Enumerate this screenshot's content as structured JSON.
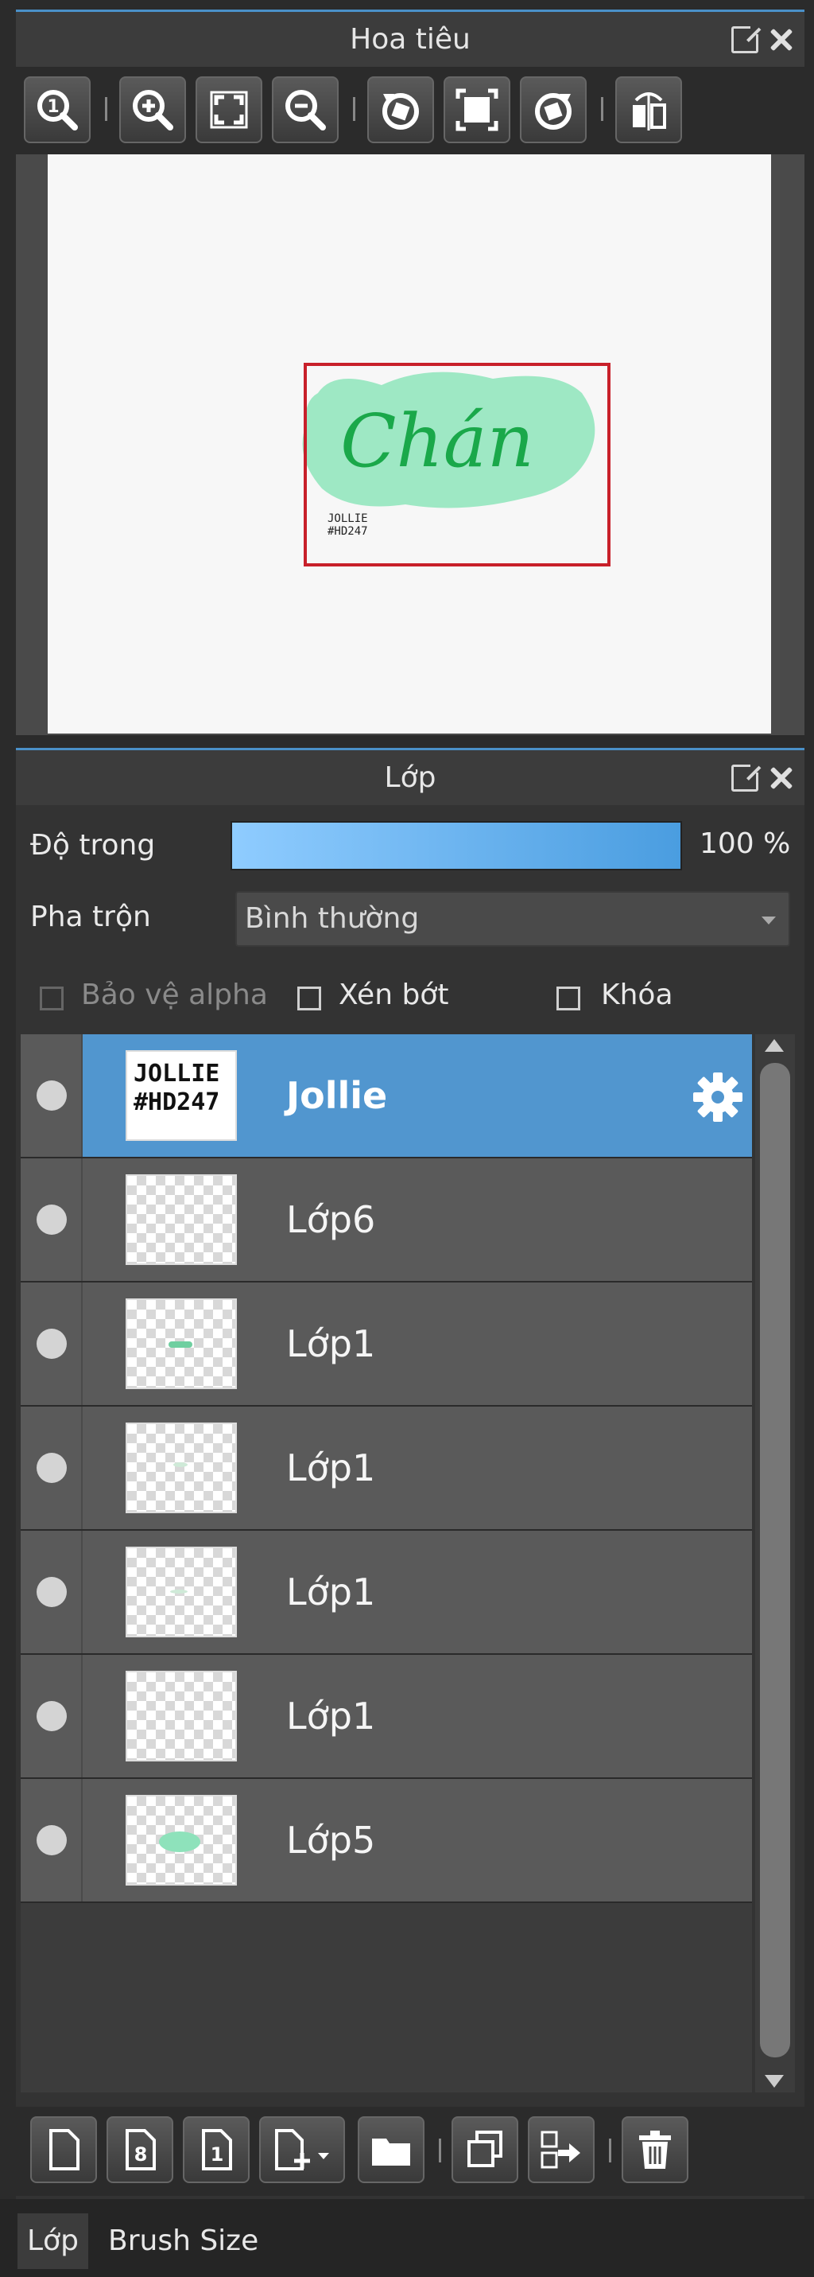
{
  "navigator": {
    "title": "Hoa tiêu",
    "tools": [
      {
        "icon": "zoom-actual-icon"
      },
      {
        "icon": "zoom-in-icon"
      },
      {
        "icon": "fit-screen-icon"
      },
      {
        "icon": "zoom-out-icon"
      },
      {
        "icon": "rotate-left-icon"
      },
      {
        "icon": "fit-canvas-icon"
      },
      {
        "icon": "rotate-right-icon"
      },
      {
        "icon": "flip-icon"
      }
    ],
    "canvas_preview_text": "Chán",
    "canvas_preview_signature": "JOLLIE #HD247"
  },
  "layers": {
    "title": "Lớp",
    "opacity_label": "Độ trong",
    "opacity_value": "100 %",
    "opacity_fraction": 1.0,
    "blend_label": "Pha trộn",
    "blend_value": "Bình thường",
    "protect_alpha_label": "Bảo vệ alpha",
    "clipping_label": "Xén bớt",
    "lock_label": "Khóa",
    "items": [
      {
        "name": "Jollie",
        "selected": true,
        "thumb": "text",
        "thumb_text_1": "JOLLIE",
        "thumb_text_2": "#HD247"
      },
      {
        "name": "Lớp6",
        "selected": false,
        "thumb": "empty"
      },
      {
        "name": "Lớp1",
        "selected": false,
        "thumb": "stroke"
      },
      {
        "name": "Lớp1",
        "selected": false,
        "thumb": "faint"
      },
      {
        "name": "Lớp1",
        "selected": false,
        "thumb": "faint"
      },
      {
        "name": "Lớp1",
        "selected": false,
        "thumb": "empty"
      },
      {
        "name": "Lớp5",
        "selected": false,
        "thumb": "blob"
      }
    ],
    "selected_color": "#5196cf",
    "accent_color": "#4a90c8"
  },
  "layer_toolbar": [
    {
      "icon": "new-layer-icon"
    },
    {
      "icon": "new-8bit-layer-icon"
    },
    {
      "icon": "new-1bit-layer-icon"
    },
    {
      "icon": "add-layer-menu-icon"
    },
    {
      "icon": "new-folder-icon"
    },
    {
      "icon": "duplicate-layer-icon"
    },
    {
      "icon": "merge-down-icon"
    },
    {
      "icon": "delete-layer-icon"
    }
  ],
  "tabs": [
    {
      "label": "Lớp",
      "active": true
    },
    {
      "label": "Brush Size",
      "active": false
    }
  ]
}
